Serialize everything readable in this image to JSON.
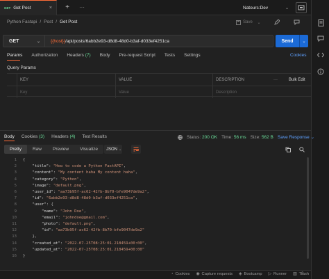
{
  "tab": {
    "method": "GET",
    "title": "Get Post",
    "close": "×",
    "plus": "+",
    "more": "···"
  },
  "environment": {
    "name": "Natours:Dev",
    "chevron": "⌄",
    "button_icon": "eye-icon"
  },
  "breadcrumb": {
    "items": [
      "Python Fastapi",
      "Post",
      "Get Post"
    ],
    "separator": "/"
  },
  "toolbar": {
    "save_label": "Save",
    "save_chevron": "⌄"
  },
  "request": {
    "method": "GET",
    "url_var": "{{host}}",
    "url_path": "/api/posts/6abb2e93-d8d8-48d0-b3af-d033ef4251ca",
    "send_label": "Send",
    "send_chevron": "⌄"
  },
  "request_tabs": [
    {
      "label": "Params",
      "count": ""
    },
    {
      "label": "Authorization",
      "count": ""
    },
    {
      "label": "Headers",
      "count": "(7)"
    },
    {
      "label": "Body",
      "count": ""
    },
    {
      "label": "Pre-request Script",
      "count": ""
    },
    {
      "label": "Tests",
      "count": ""
    },
    {
      "label": "Settings",
      "count": ""
    }
  ],
  "cookies_link": "Cookies",
  "query_params": {
    "label": "Query Params",
    "headers": {
      "key": "KEY",
      "value": "VALUE",
      "description": "DESCRIPTION",
      "more": "···",
      "bulk_edit": "Bulk Edit"
    },
    "placeholders": {
      "key": "Key",
      "value": "Value",
      "description": "Description"
    }
  },
  "response": {
    "tabs": [
      {
        "label": "Body",
        "count": ""
      },
      {
        "label": "Cookies",
        "count": "(3)"
      },
      {
        "label": "Headers",
        "count": "(4)"
      },
      {
        "label": "Test Results",
        "count": ""
      }
    ],
    "status_label": "Status:",
    "status_value": "200 OK",
    "time_label": "Time:",
    "time_value": "56 ms",
    "size_label": "Size:",
    "size_value": "562 B",
    "save_response": "Save Response",
    "save_chevron": "⌄",
    "globe_icon": "globe-icon"
  },
  "format": {
    "modes": [
      "Pretty",
      "Raw",
      "Preview",
      "Visualize"
    ],
    "active": "Pretty",
    "language": "JSON",
    "language_chevron": "⌄"
  },
  "code_lines": [
    {
      "n": "1",
      "t": "{"
    },
    {
      "n": "2",
      "t": "    \"title\": \"How to code a Python FastAPI\","
    },
    {
      "n": "3",
      "t": "    \"content\": \"My content haha My content haha\","
    },
    {
      "n": "4",
      "t": "    \"category\": \"Python\","
    },
    {
      "n": "5",
      "t": "    \"image\": \"default.png\","
    },
    {
      "n": "6",
      "t": "    \"user_id\": \"aa73b95f-ac62-42fb-8b70-bfe9047de9a2\","
    },
    {
      "n": "7",
      "t": "    \"id\": \"6abb2e93-d8d8-48d0-b3af-d033ef4251ca\","
    },
    {
      "n": "8",
      "t": "    \"user\": {"
    },
    {
      "n": "9",
      "t": "        \"name\": \"John Doe\","
    },
    {
      "n": "10",
      "t": "        \"email\": \"johndoe@gmail.com\","
    },
    {
      "n": "11",
      "t": "        \"photo\": \"default.png\","
    },
    {
      "n": "12",
      "t": "        \"id\": \"aa73b95f-ac62-42fb-8b70-bfe9047de9a2\""
    },
    {
      "n": "13",
      "t": "    },"
    },
    {
      "n": "14",
      "t": "    \"created_at\": \"2022-07-25T08:25:01.218459+00:00\","
    },
    {
      "n": "15",
      "t": "    \"updated_at\": \"2022-07-25T08:25:01.218459+00:00\""
    },
    {
      "n": "16",
      "t": "}"
    }
  ],
  "footer": {
    "items": [
      {
        "icon": "cookie-icon",
        "glyph": "◔",
        "label": "Cookies"
      },
      {
        "icon": "capture-icon",
        "glyph": "◉",
        "label": "Capture requests"
      },
      {
        "icon": "bootcamp-icon",
        "glyph": "◈",
        "label": "Bootcamp"
      },
      {
        "icon": "runner-icon",
        "glyph": "▷",
        "label": "Runner"
      },
      {
        "icon": "trash-icon",
        "glyph": "▥",
        "label": "Trash"
      }
    ],
    "help": "?"
  },
  "colors": {
    "accent": "#ff6c37",
    "send": "#1b6ad6",
    "get": "#6bdd9a",
    "link": "#5ea1ff",
    "string": "#ce9178"
  }
}
